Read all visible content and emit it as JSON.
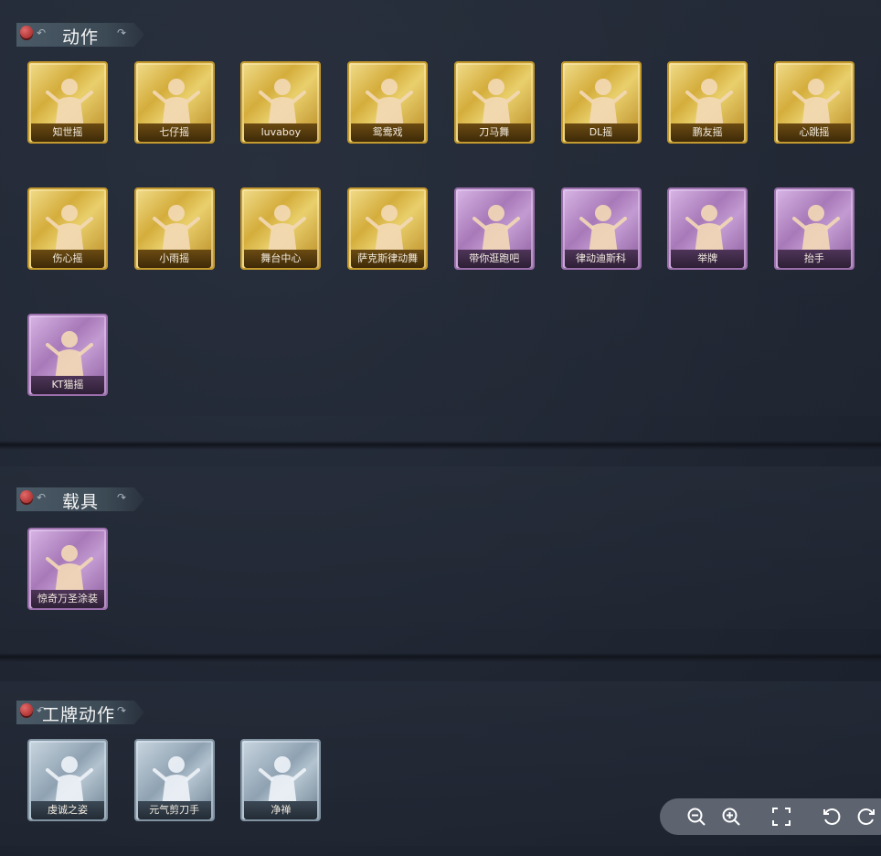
{
  "sections": [
    {
      "title": "动作",
      "cards": [
        {
          "label": "知世摇",
          "rarity": "gold"
        },
        {
          "label": "七仔摇",
          "rarity": "gold"
        },
        {
          "label": "luvaboy",
          "rarity": "gold"
        },
        {
          "label": "鸳鸯戏",
          "rarity": "gold"
        },
        {
          "label": "刀马舞",
          "rarity": "gold"
        },
        {
          "label": "DL摇",
          "rarity": "gold"
        },
        {
          "label": "鹏友摇",
          "rarity": "gold"
        },
        {
          "label": "心跳摇",
          "rarity": "gold"
        },
        {
          "label": "伤心摇",
          "rarity": "gold"
        },
        {
          "label": "小雨摇",
          "rarity": "gold"
        },
        {
          "label": "舞台中心",
          "rarity": "gold"
        },
        {
          "label": "萨克斯律动舞",
          "rarity": "gold"
        },
        {
          "label": "带你逛跑吧",
          "rarity": "purple"
        },
        {
          "label": "律动迪斯科",
          "rarity": "purple"
        },
        {
          "label": "举牌",
          "rarity": "purple"
        },
        {
          "label": "抬手",
          "rarity": "purple"
        },
        {
          "label": "KT猫摇",
          "rarity": "purple"
        }
      ]
    },
    {
      "title": "载具",
      "cards": [
        {
          "label": "惊奇万圣涂装",
          "rarity": "purple"
        }
      ]
    },
    {
      "title": "工牌动作",
      "cards": [
        {
          "label": "虔诚之姿",
          "rarity": "blue"
        },
        {
          "label": "元气剪刀手",
          "rarity": "blue"
        },
        {
          "label": "净禅",
          "rarity": "blue"
        }
      ]
    }
  ],
  "toolbar": {
    "icons": [
      "zoom-out-icon",
      "zoom-in-icon",
      "fullscreen-icon",
      "rotate-left-icon",
      "rotate-right-icon"
    ]
  },
  "colors": {
    "gold": "#d4ad3c",
    "purple": "#a879b8",
    "blue": "#8fa2b2",
    "background": "#1f2531"
  }
}
